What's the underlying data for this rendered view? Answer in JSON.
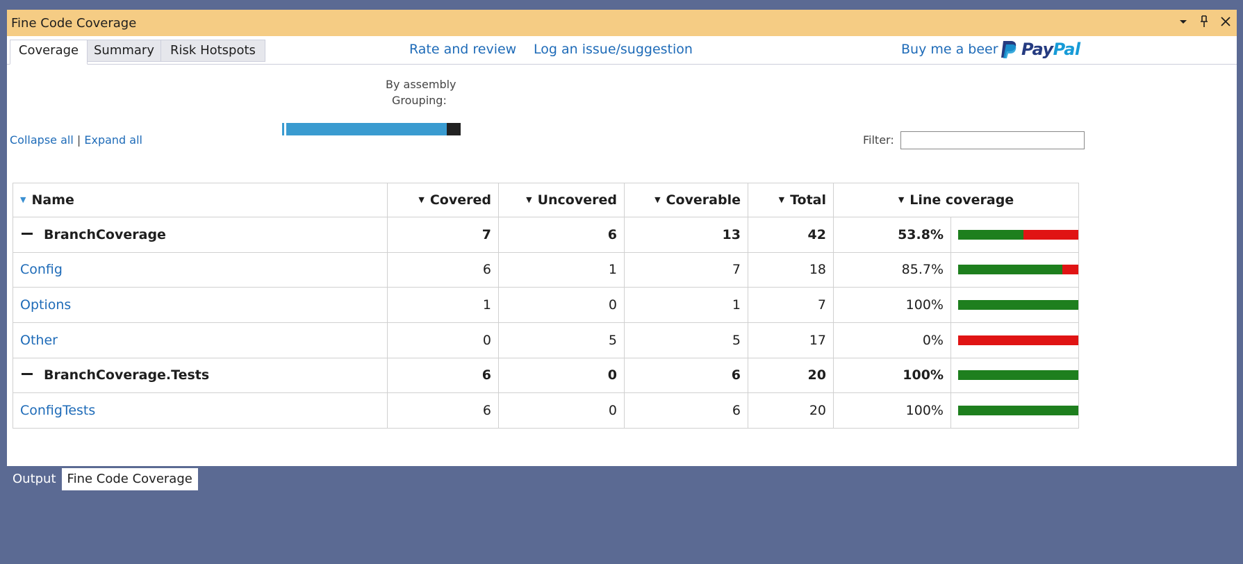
{
  "window": {
    "title": "Fine Code Coverage",
    "controls": [
      "dropdown-icon",
      "pin-icon",
      "close-icon"
    ]
  },
  "tabs": [
    {
      "label": "Coverage",
      "active": true
    },
    {
      "label": "Summary",
      "active": false
    },
    {
      "label": "Risk Hotspots",
      "active": false
    }
  ],
  "links": {
    "rate": "Rate and review",
    "issue": "Log an issue/suggestion",
    "beer": "Buy me a beer",
    "paypal_pay": "Pay",
    "paypal_pal": "Pal"
  },
  "grouping": {
    "value": "By assembly",
    "label": "Grouping:"
  },
  "tree_controls": {
    "collapse": "Collapse all",
    "separator": "|",
    "expand": "Expand all"
  },
  "coverage_bar": {
    "covered_fraction": 0.52,
    "uncovered_fraction": 0.04
  },
  "filter": {
    "label": "Filter:",
    "value": ""
  },
  "table": {
    "columns": [
      "Name",
      "Covered",
      "Uncovered",
      "Coverable",
      "Total",
      "Line coverage"
    ],
    "rows": [
      {
        "kind": "group",
        "name": "BranchCoverage",
        "covered": "7",
        "uncovered": "6",
        "coverable": "13",
        "total": "42",
        "percent": "53.8%",
        "fraction": 0.538
      },
      {
        "kind": "class",
        "name": "Config",
        "covered": "6",
        "uncovered": "1",
        "coverable": "7",
        "total": "18",
        "percent": "85.7%",
        "fraction": 0.857
      },
      {
        "kind": "class",
        "name": "Options",
        "covered": "1",
        "uncovered": "0",
        "coverable": "1",
        "total": "7",
        "percent": "100%",
        "fraction": 1.0
      },
      {
        "kind": "class",
        "name": "Other",
        "covered": "0",
        "uncovered": "5",
        "coverable": "5",
        "total": "17",
        "percent": "0%",
        "fraction": 0.0
      },
      {
        "kind": "group",
        "name": "BranchCoverage.Tests",
        "covered": "6",
        "uncovered": "0",
        "coverable": "6",
        "total": "20",
        "percent": "100%",
        "fraction": 1.0
      },
      {
        "kind": "class",
        "name": "ConfigTests",
        "covered": "6",
        "uncovered": "0",
        "coverable": "6",
        "total": "20",
        "percent": "100%",
        "fraction": 1.0
      }
    ]
  },
  "bottom_tabs": [
    {
      "label": "Output",
      "active": false
    },
    {
      "label": "Fine Code Coverage",
      "active": true
    }
  ],
  "colors": {
    "title_bar": "#f5cc84",
    "link": "#1e6bb8",
    "covered": "#1e7f1e",
    "uncovered": "#e01414",
    "assembly_covered": "#3a9bd0",
    "assembly_uncovered": "#222222",
    "background": "#5b6a93"
  }
}
